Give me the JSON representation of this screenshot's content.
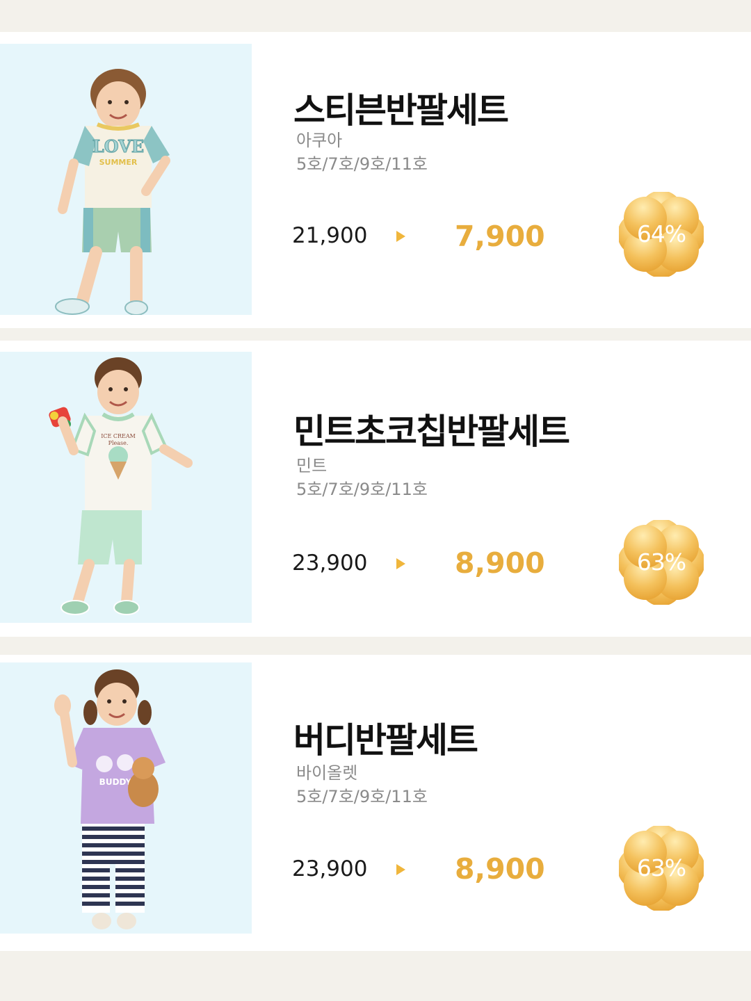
{
  "products": [
    {
      "name": "스티븐반팔세트",
      "color": "아쿠아",
      "sizes": "5호/7호/9호/11호",
      "original_price": "21,900",
      "sale_price": "7,900",
      "discount": "64%"
    },
    {
      "name": "민트초코칩반팔세트",
      "color": "민트",
      "sizes": "5호/7호/9호/11호",
      "original_price": "23,900",
      "sale_price": "8,900",
      "discount": "63%"
    },
    {
      "name": "버디반팔세트",
      "color": "바이올렛",
      "sizes": "5호/7호/9호/11호",
      "original_price": "23,900",
      "sale_price": "8,900",
      "discount": "63%"
    }
  ],
  "print": {
    "love": "LOVE",
    "summer": "SUMMER",
    "ice_cream": "ICE CREAM",
    "please": "Please.",
    "buddy": "BUDDY"
  },
  "colors": {
    "background": "#f3f1eb",
    "card": "#ffffff",
    "photo_bg": "#e6f6fb",
    "accent": "#e8ad3d",
    "badge_light": "#ffe9a8",
    "badge_dark": "#e9a733",
    "secondary_text": "#8a8a8a"
  },
  "icons": {
    "arrow": "triangle-right-icon",
    "badge": "flower-badge-icon"
  }
}
